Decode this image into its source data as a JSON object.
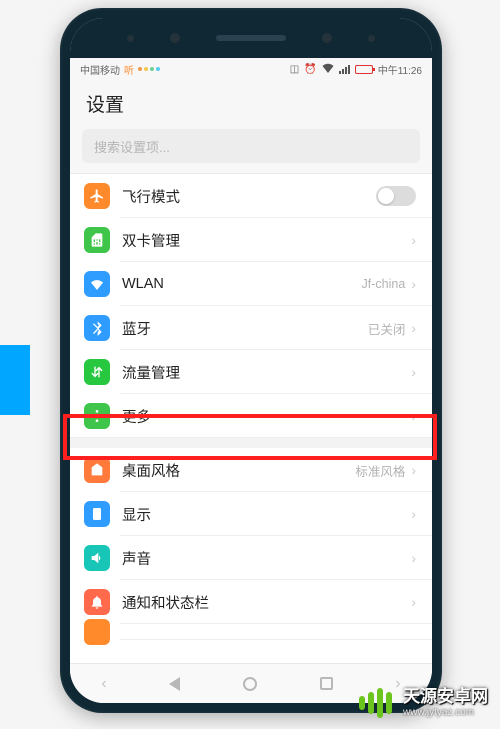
{
  "status": {
    "carrier": "中国移动",
    "extra": "听",
    "vibrate_icon": "vibrate",
    "alarm_icon": "alarm",
    "wifi_icon": "wifi",
    "time": "中午11:26"
  },
  "header": {
    "title": "设置"
  },
  "search": {
    "placeholder": "搜索设置项..."
  },
  "rows": {
    "airplane": {
      "label": "飞行模式",
      "icon": "airplane-icon",
      "color": "#ff8a2b"
    },
    "dualsim": {
      "label": "双卡管理",
      "icon": "sim-icon",
      "color": "#3ec54a"
    },
    "wlan": {
      "label": "WLAN",
      "icon": "wifi-icon",
      "color": "#2f9dff",
      "value": "Jf-china"
    },
    "bluetooth": {
      "label": "蓝牙",
      "icon": "bluetooth-icon",
      "color": "#2f9dff",
      "value": "已关闭"
    },
    "data": {
      "label": "流量管理",
      "icon": "data-icon",
      "color": "#27c840"
    },
    "more": {
      "label": "更多",
      "icon": "more-icon",
      "color": "#3ec54a"
    },
    "theme": {
      "label": "桌面风格",
      "icon": "theme-icon",
      "color": "#ff7a3b",
      "value": "标准风格"
    },
    "display": {
      "label": "显示",
      "icon": "display-icon",
      "color": "#2f9dff"
    },
    "sound": {
      "label": "声音",
      "icon": "sound-icon",
      "color": "#17c6b6"
    },
    "notif": {
      "label": "通知和状态栏",
      "icon": "bell-icon",
      "color": "#ff6a4d"
    }
  },
  "banner": {
    "title": "天源安卓网",
    "url": "www.jytyaz.com"
  }
}
